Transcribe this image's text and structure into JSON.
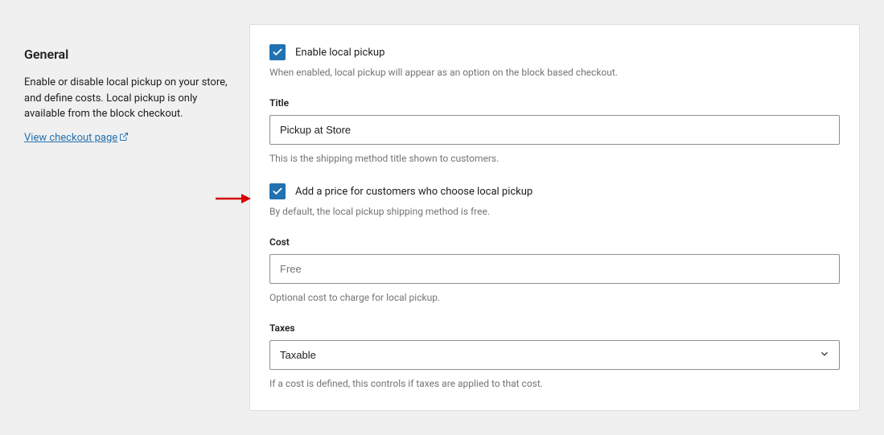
{
  "sidebar": {
    "title": "General",
    "description": "Enable or disable local pickup on your store, and define costs. Local pickup is only available from the block checkout.",
    "link_label": "View checkout page"
  },
  "panel": {
    "enable": {
      "label": "Enable local pickup",
      "help": "When enabled, local pickup will appear as an option on the block based checkout."
    },
    "title_field": {
      "label": "Title",
      "value": "Pickup at Store",
      "help": "This is the shipping method title shown to customers."
    },
    "add_price": {
      "label": "Add a price for customers who choose local pickup",
      "help": "By default, the local pickup shipping method is free."
    },
    "cost": {
      "label": "Cost",
      "placeholder": "Free",
      "value": "",
      "help": "Optional cost to charge for local pickup."
    },
    "taxes": {
      "label": "Taxes",
      "value": "Taxable",
      "help": "If a cost is defined, this controls if taxes are applied to that cost."
    }
  }
}
